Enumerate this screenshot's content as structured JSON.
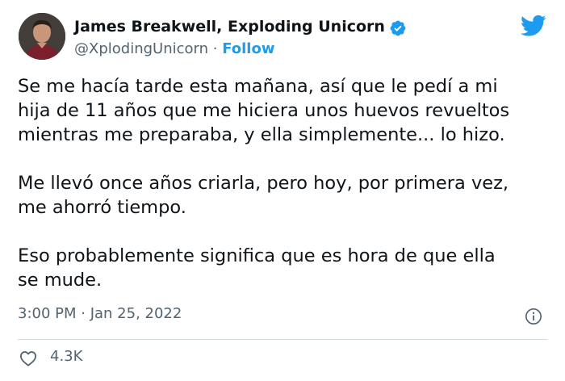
{
  "author": {
    "display_name": "James Breakwell, Exploding Unicorn",
    "handle": "@XplodingUnicorn",
    "separator": " · ",
    "follow_label": "Follow"
  },
  "tweet": {
    "paragraphs": [
      "Se me hacía tarde esta mañana, así que le pedí a mi\nhija de 11 años que me hiciera unos huevos revueltos\nmientras me preparaba, y ella simplemente... lo hizo.",
      "Me llevó once años criarla, pero hoy, por primera vez,\nme ahorró tiempo.",
      "Eso probablemente significa que es hora de que ella\nse mude."
    ],
    "timestamp": "3:00 PM · Jan 25, 2022",
    "like_count": "4.3K"
  },
  "icons": {
    "verified": "verified-badge-icon",
    "brand": "twitter-bird-icon",
    "info": "info-icon",
    "like": "heart-icon"
  },
  "colors": {
    "accent": "#1d9bf0",
    "text": "#0f1419",
    "secondary": "#536471",
    "divider": "#cfd9de"
  }
}
